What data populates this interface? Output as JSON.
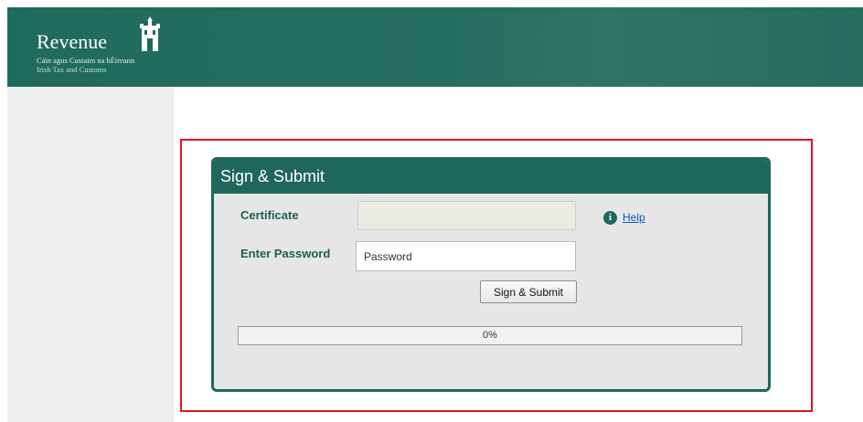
{
  "header": {
    "brand": "Revenue",
    "subtitle_irish": "Cáin agus Custaim na hÉireann",
    "subtitle_english": "Irish Tax and Customs",
    "logo_icon": "castle-icon",
    "colors": {
      "background": "#1f6a5e"
    }
  },
  "dialog": {
    "title": "Sign & Submit",
    "certificate_label": "Certificate",
    "certificate_value": "",
    "password_label": "Enter Password",
    "password_placeholder": "Password",
    "password_value": "",
    "help_icon": "info-icon",
    "help_label": "Help",
    "submit_label": "Sign & Submit",
    "progress_value": 0,
    "progress_text": "0%",
    "colors": {
      "header": "#1f675c",
      "panel": "#e6e6e6",
      "highlight": "#e0141e"
    }
  }
}
